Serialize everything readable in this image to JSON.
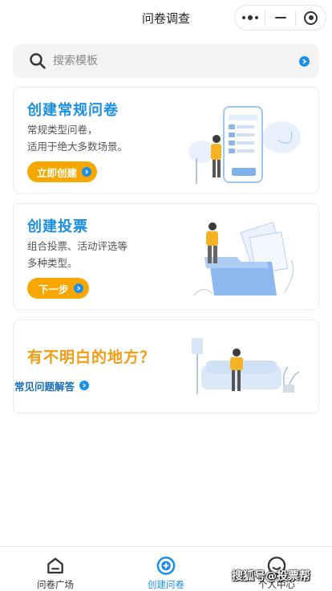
{
  "header": {
    "title": "问卷调查"
  },
  "search": {
    "placeholder": "搜索模板"
  },
  "cards": [
    {
      "title": "创建常规问卷",
      "desc_line1": "常规类型问卷，",
      "desc_line2": "适用于绝大多数场景。",
      "button": "立即创建"
    },
    {
      "title": "创建投票",
      "desc_line1": "组合投票、活动评选等",
      "desc_line2": "多种类型。",
      "button": "下一步"
    },
    {
      "title": "有不明白的地方？",
      "link": "常见问题解答"
    }
  ],
  "tabbar": {
    "items": [
      {
        "label": "问卷广场",
        "icon": "home-icon"
      },
      {
        "label": "创建问卷",
        "icon": "add-circle-icon"
      },
      {
        "label": "个人中心",
        "icon": "user-icon"
      }
    ],
    "active_index": 1
  },
  "watermark": "搜狐号@投票帮",
  "colors": {
    "primary": "#1a8ee6",
    "accent": "#f7a800",
    "faq_title": "#f39c12"
  }
}
